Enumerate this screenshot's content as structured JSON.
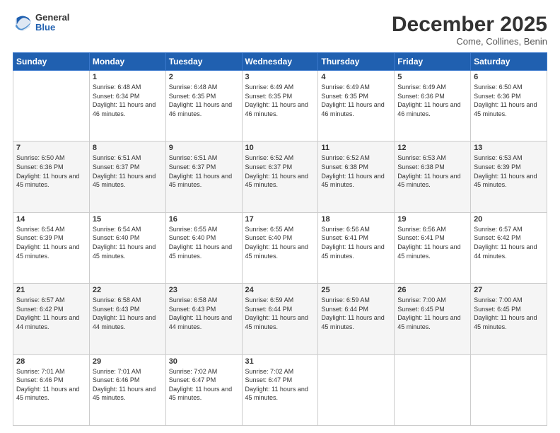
{
  "header": {
    "logo_general": "General",
    "logo_blue": "Blue",
    "month_title": "December 2025",
    "location": "Come, Collines, Benin"
  },
  "days_of_week": [
    "Sunday",
    "Monday",
    "Tuesday",
    "Wednesday",
    "Thursday",
    "Friday",
    "Saturday"
  ],
  "weeks": [
    [
      {
        "day": "",
        "sunrise": "",
        "sunset": "",
        "daylight": ""
      },
      {
        "day": "1",
        "sunrise": "Sunrise: 6:48 AM",
        "sunset": "Sunset: 6:34 PM",
        "daylight": "Daylight: 11 hours and 46 minutes."
      },
      {
        "day": "2",
        "sunrise": "Sunrise: 6:48 AM",
        "sunset": "Sunset: 6:35 PM",
        "daylight": "Daylight: 11 hours and 46 minutes."
      },
      {
        "day": "3",
        "sunrise": "Sunrise: 6:49 AM",
        "sunset": "Sunset: 6:35 PM",
        "daylight": "Daylight: 11 hours and 46 minutes."
      },
      {
        "day": "4",
        "sunrise": "Sunrise: 6:49 AM",
        "sunset": "Sunset: 6:35 PM",
        "daylight": "Daylight: 11 hours and 46 minutes."
      },
      {
        "day": "5",
        "sunrise": "Sunrise: 6:49 AM",
        "sunset": "Sunset: 6:36 PM",
        "daylight": "Daylight: 11 hours and 46 minutes."
      },
      {
        "day": "6",
        "sunrise": "Sunrise: 6:50 AM",
        "sunset": "Sunset: 6:36 PM",
        "daylight": "Daylight: 11 hours and 45 minutes."
      }
    ],
    [
      {
        "day": "7",
        "sunrise": "Sunrise: 6:50 AM",
        "sunset": "Sunset: 6:36 PM",
        "daylight": "Daylight: 11 hours and 45 minutes."
      },
      {
        "day": "8",
        "sunrise": "Sunrise: 6:51 AM",
        "sunset": "Sunset: 6:37 PM",
        "daylight": "Daylight: 11 hours and 45 minutes."
      },
      {
        "day": "9",
        "sunrise": "Sunrise: 6:51 AM",
        "sunset": "Sunset: 6:37 PM",
        "daylight": "Daylight: 11 hours and 45 minutes."
      },
      {
        "day": "10",
        "sunrise": "Sunrise: 6:52 AM",
        "sunset": "Sunset: 6:37 PM",
        "daylight": "Daylight: 11 hours and 45 minutes."
      },
      {
        "day": "11",
        "sunrise": "Sunrise: 6:52 AM",
        "sunset": "Sunset: 6:38 PM",
        "daylight": "Daylight: 11 hours and 45 minutes."
      },
      {
        "day": "12",
        "sunrise": "Sunrise: 6:53 AM",
        "sunset": "Sunset: 6:38 PM",
        "daylight": "Daylight: 11 hours and 45 minutes."
      },
      {
        "day": "13",
        "sunrise": "Sunrise: 6:53 AM",
        "sunset": "Sunset: 6:39 PM",
        "daylight": "Daylight: 11 hours and 45 minutes."
      }
    ],
    [
      {
        "day": "14",
        "sunrise": "Sunrise: 6:54 AM",
        "sunset": "Sunset: 6:39 PM",
        "daylight": "Daylight: 11 hours and 45 minutes."
      },
      {
        "day": "15",
        "sunrise": "Sunrise: 6:54 AM",
        "sunset": "Sunset: 6:40 PM",
        "daylight": "Daylight: 11 hours and 45 minutes."
      },
      {
        "day": "16",
        "sunrise": "Sunrise: 6:55 AM",
        "sunset": "Sunset: 6:40 PM",
        "daylight": "Daylight: 11 hours and 45 minutes."
      },
      {
        "day": "17",
        "sunrise": "Sunrise: 6:55 AM",
        "sunset": "Sunset: 6:40 PM",
        "daylight": "Daylight: 11 hours and 45 minutes."
      },
      {
        "day": "18",
        "sunrise": "Sunrise: 6:56 AM",
        "sunset": "Sunset: 6:41 PM",
        "daylight": "Daylight: 11 hours and 45 minutes."
      },
      {
        "day": "19",
        "sunrise": "Sunrise: 6:56 AM",
        "sunset": "Sunset: 6:41 PM",
        "daylight": "Daylight: 11 hours and 45 minutes."
      },
      {
        "day": "20",
        "sunrise": "Sunrise: 6:57 AM",
        "sunset": "Sunset: 6:42 PM",
        "daylight": "Daylight: 11 hours and 44 minutes."
      }
    ],
    [
      {
        "day": "21",
        "sunrise": "Sunrise: 6:57 AM",
        "sunset": "Sunset: 6:42 PM",
        "daylight": "Daylight: 11 hours and 44 minutes."
      },
      {
        "day": "22",
        "sunrise": "Sunrise: 6:58 AM",
        "sunset": "Sunset: 6:43 PM",
        "daylight": "Daylight: 11 hours and 44 minutes."
      },
      {
        "day": "23",
        "sunrise": "Sunrise: 6:58 AM",
        "sunset": "Sunset: 6:43 PM",
        "daylight": "Daylight: 11 hours and 44 minutes."
      },
      {
        "day": "24",
        "sunrise": "Sunrise: 6:59 AM",
        "sunset": "Sunset: 6:44 PM",
        "daylight": "Daylight: 11 hours and 45 minutes."
      },
      {
        "day": "25",
        "sunrise": "Sunrise: 6:59 AM",
        "sunset": "Sunset: 6:44 PM",
        "daylight": "Daylight: 11 hours and 45 minutes."
      },
      {
        "day": "26",
        "sunrise": "Sunrise: 7:00 AM",
        "sunset": "Sunset: 6:45 PM",
        "daylight": "Daylight: 11 hours and 45 minutes."
      },
      {
        "day": "27",
        "sunrise": "Sunrise: 7:00 AM",
        "sunset": "Sunset: 6:45 PM",
        "daylight": "Daylight: 11 hours and 45 minutes."
      }
    ],
    [
      {
        "day": "28",
        "sunrise": "Sunrise: 7:01 AM",
        "sunset": "Sunset: 6:46 PM",
        "daylight": "Daylight: 11 hours and 45 minutes."
      },
      {
        "day": "29",
        "sunrise": "Sunrise: 7:01 AM",
        "sunset": "Sunset: 6:46 PM",
        "daylight": "Daylight: 11 hours and 45 minutes."
      },
      {
        "day": "30",
        "sunrise": "Sunrise: 7:02 AM",
        "sunset": "Sunset: 6:47 PM",
        "daylight": "Daylight: 11 hours and 45 minutes."
      },
      {
        "day": "31",
        "sunrise": "Sunrise: 7:02 AM",
        "sunset": "Sunset: 6:47 PM",
        "daylight": "Daylight: 11 hours and 45 minutes."
      },
      {
        "day": "",
        "sunrise": "",
        "sunset": "",
        "daylight": ""
      },
      {
        "day": "",
        "sunrise": "",
        "sunset": "",
        "daylight": ""
      },
      {
        "day": "",
        "sunrise": "",
        "sunset": "",
        "daylight": ""
      }
    ]
  ]
}
